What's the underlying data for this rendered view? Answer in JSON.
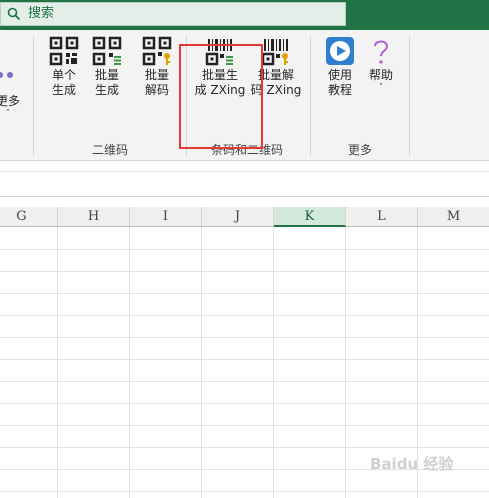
{
  "search": {
    "label": "搜索"
  },
  "ribbon": {
    "more_partial": {
      "line1": "更多"
    },
    "buttons": [
      {
        "line1": "单个",
        "line2": "生成"
      },
      {
        "line1": "批量",
        "line2": "生成"
      },
      {
        "line1": "批量",
        "line2": "解码"
      },
      {
        "line1": "批量生",
        "line2": "成 ZXing"
      },
      {
        "line1": "批量解",
        "line2": "码 ZXing"
      },
      {
        "line1": "使用",
        "line2": "教程"
      },
      {
        "line1": "帮助"
      }
    ],
    "groups": {
      "qr": "二维码",
      "barcode": "条码和二维码",
      "more": "更多"
    }
  },
  "sheet": {
    "columns": [
      "G",
      "H",
      "I",
      "J",
      "K",
      "L",
      "M"
    ],
    "selected_column": "K"
  },
  "watermark": "Baidu 经验",
  "colors": {
    "accent": "#217346",
    "highlight": "#e53935"
  }
}
